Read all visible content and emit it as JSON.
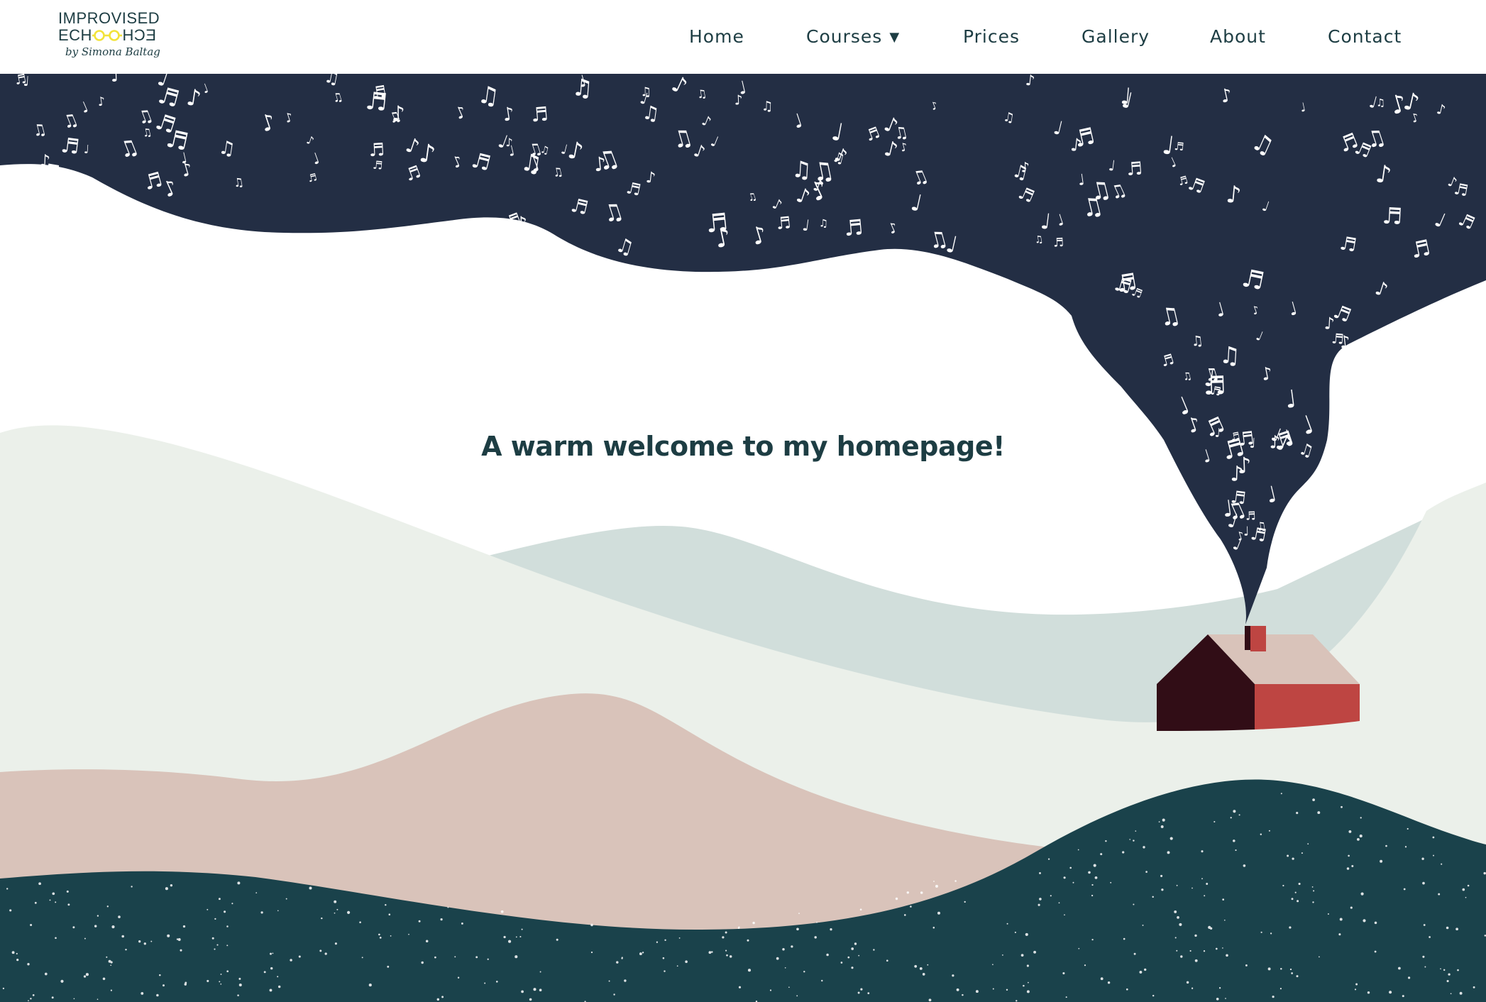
{
  "logo": {
    "line1": "IMPROVISED",
    "line2_left": "ECH",
    "line2_right": "ECH",
    "line3": "by Simona Baltag",
    "glasses_color": "#f2e33a"
  },
  "nav": {
    "items": [
      {
        "label": "Home"
      },
      {
        "label": "Courses",
        "caret": "▼"
      },
      {
        "label": "Prices"
      },
      {
        "label": "Gallery"
      },
      {
        "label": "About"
      },
      {
        "label": "Contact"
      }
    ]
  },
  "hero": {
    "heading": "A warm welcome to my homepage!"
  },
  "colors": {
    "sky": "#232e44",
    "text": "#1d3d43",
    "hill_light": "#ebf0ea",
    "hill_blue": "#d1dedb",
    "hill_pink": "#d9c3ba",
    "hill_dark": "#1a424b",
    "house_dark": "#310d16",
    "house_red": "#be4542",
    "roof": "#d9c3ba"
  }
}
